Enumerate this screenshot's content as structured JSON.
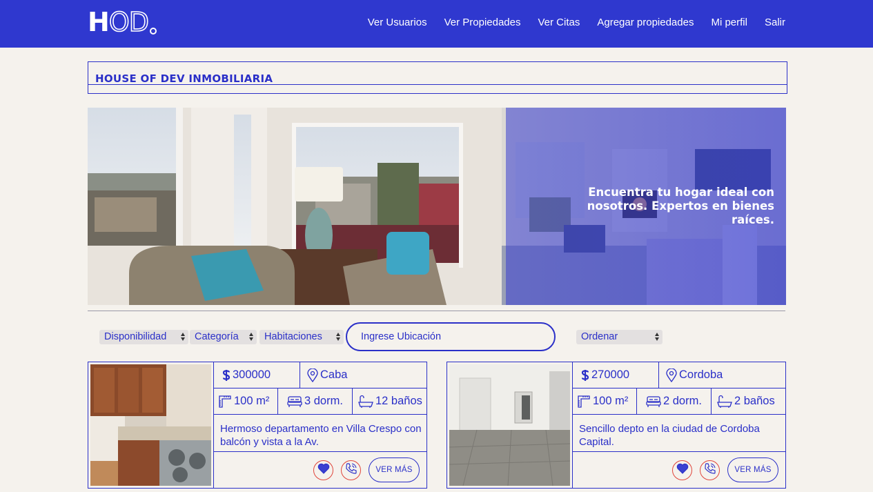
{
  "nav": {
    "logo": {
      "h": "H",
      "rest": "OD"
    },
    "links": [
      "Ver Usuarios",
      "Ver Propiedades",
      "Ver Citas",
      "Agregar propiedades",
      "Mi perfil",
      "Salir"
    ]
  },
  "header": {
    "title": "HOUSE OF DEV INMOBILIARIA"
  },
  "hero": {
    "tagline_1": "Encuentra tu hogar ideal con",
    "tagline_2": "nosotros. Expertos en bienes",
    "tagline_3": "raíces."
  },
  "filters": {
    "disponibilidad": "Disponibilidad",
    "categoria": "Categoría",
    "habitaciones": "Habitaciones",
    "location_placeholder": "Ingrese Ubicación",
    "ordenar": "Ordenar"
  },
  "properties": [
    {
      "price": "300000",
      "location": "Caba",
      "area": "100 m²",
      "rooms": "3 dorm.",
      "baths": "12 baños",
      "description": "Hermoso departamento en Villa Crespo con balcón y vista a la Av.",
      "cta": "VER MÁS"
    },
    {
      "price": "270000",
      "location": "Cordoba",
      "area": "100 m²",
      "rooms": "2 dorm.",
      "baths": "2 baños",
      "description": "Sencillo depto en la ciudad de Cordoba Capital.",
      "cta": "VER MÁS"
    }
  ],
  "colors": {
    "primary": "#2f38cf",
    "background": "#f5f2ed",
    "accent_red": "#e0463c"
  }
}
